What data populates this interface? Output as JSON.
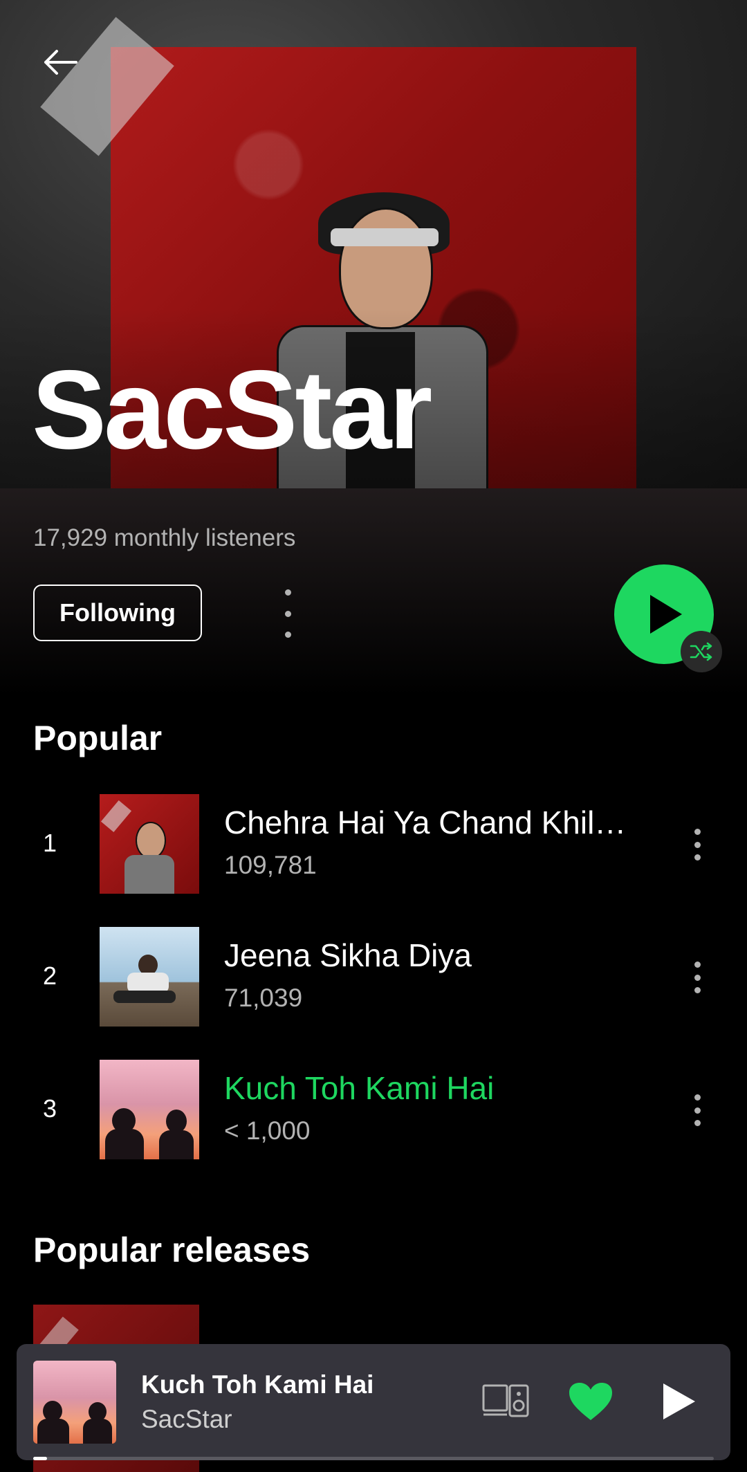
{
  "artist": {
    "name": "SacStar",
    "monthly_listeners": "17,929 monthly listeners"
  },
  "actions": {
    "follow_label": "Following"
  },
  "popular": {
    "title": "Popular",
    "tracks": [
      {
        "rank": "1",
        "title": "Chehra Hai Ya Chand Khil…",
        "plays": "109,781",
        "playing": false
      },
      {
        "rank": "2",
        "title": "Jeena Sikha Diya",
        "plays": "71,039",
        "playing": false
      },
      {
        "rank": "3",
        "title": "Kuch Toh Kami Hai",
        "plays": "< 1,000",
        "playing": true
      }
    ]
  },
  "popular_releases": {
    "title": "Popular releases"
  },
  "now_playing": {
    "title": "Kuch Toh Kami Hai",
    "artist": "SacStar",
    "progress": 0.02,
    "liked": true
  },
  "colors": {
    "accent": "#1ed760",
    "mini_player_bg": "#35343c",
    "secondary_text": "#b3b3b3"
  },
  "icons": {
    "back": "arrow-left-icon",
    "more": "more-vertical-icon",
    "play": "play-icon",
    "shuffle": "shuffle-icon",
    "devices": "devices-icon",
    "like": "heart-filled-icon"
  }
}
